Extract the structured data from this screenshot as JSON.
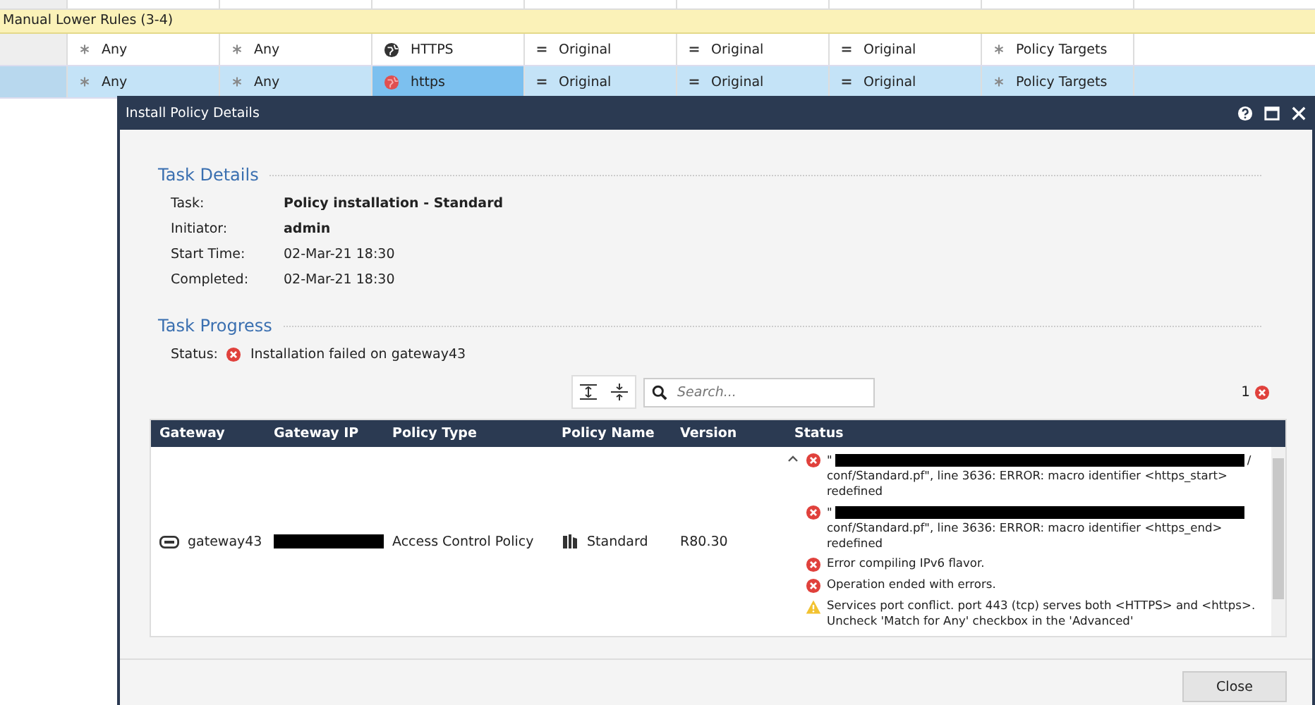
{
  "rules": {
    "section_title": "Manual Lower Rules (3-4)",
    "rows": [
      {
        "selected": false,
        "cells": [
          {
            "kind": "any",
            "text": "Any"
          },
          {
            "kind": "any",
            "text": "Any"
          },
          {
            "kind": "service",
            "text": "HTTPS"
          },
          {
            "kind": "original",
            "text": "Original"
          },
          {
            "kind": "original",
            "text": "Original"
          },
          {
            "kind": "original",
            "text": "Original"
          },
          {
            "kind": "any",
            "text": "Policy Targets"
          }
        ]
      },
      {
        "selected": true,
        "cells": [
          {
            "kind": "any",
            "text": "Any"
          },
          {
            "kind": "any",
            "text": "Any"
          },
          {
            "kind": "service-custom",
            "text": "https",
            "selected": true
          },
          {
            "kind": "original",
            "text": "Original"
          },
          {
            "kind": "original",
            "text": "Original"
          },
          {
            "kind": "original",
            "text": "Original"
          },
          {
            "kind": "any",
            "text": "Policy Targets"
          }
        ]
      }
    ]
  },
  "dialog": {
    "title": "Install Policy Details",
    "task_details": {
      "heading": "Task Details",
      "fields": [
        {
          "label": "Task:",
          "value": "Policy installation - Standard",
          "bold": true
        },
        {
          "label": "Initiator:",
          "value": "admin",
          "bold": true
        },
        {
          "label": "Start Time:",
          "value": "02-Mar-21 18:30",
          "bold": false
        },
        {
          "label": "Completed:",
          "value": "02-Mar-21 18:30",
          "bold": false
        }
      ]
    },
    "task_progress": {
      "heading": "Task Progress",
      "status_label": "Status:",
      "status": "Installation failed on gateway43"
    },
    "search": {
      "placeholder": "Search..."
    },
    "error_count": "1",
    "table": {
      "columns": [
        "Gateway",
        "Gateway IP",
        "Policy Type",
        "Policy Name",
        "Version",
        "Status"
      ],
      "row": {
        "gateway": "gateway43",
        "policy_type": "Access Control Policy",
        "policy_name": "Standard",
        "version": "R80.30",
        "messages": [
          {
            "kind": "error",
            "redacted": true,
            "prefix": "\"",
            "suffix": "/",
            "text": "conf/Standard.pf\", line 3636: ERROR: macro identifier <https_start> redefined"
          },
          {
            "kind": "error",
            "redacted": true,
            "prefix": "\"",
            "text": "conf/Standard.pf\", line 3636: ERROR: macro identifier <https_end> redefined"
          },
          {
            "kind": "error",
            "redacted": false,
            "text": "Error compiling IPv6 flavor."
          },
          {
            "kind": "error",
            "redacted": false,
            "text": "Operation ended with errors."
          },
          {
            "kind": "warning",
            "redacted": false,
            "text": "Services port conflict. port 443 (tcp) serves both <HTTPS> and <https>. Uncheck 'Match for Any' checkbox in the 'Advanced'"
          }
        ]
      }
    },
    "close_button": "Close"
  }
}
